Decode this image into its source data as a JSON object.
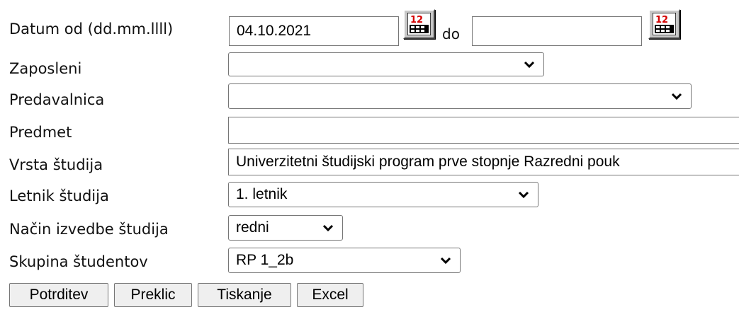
{
  "form": {
    "date_from_label": "Datum od (dd.mm.llll)",
    "date_from_value": "04.10.2021",
    "date_to_label": "do",
    "date_to_value": "",
    "employee_label": "Zaposleni",
    "employee_value": "",
    "room_label": "Predavalnica",
    "room_value": "",
    "subject_label": "Predmet",
    "subject_value": "",
    "study_type_label": "Vrsta študija",
    "study_type_value": "Univerzitetni študijski program prve stopnje Razredni pouk",
    "study_year_label": "Letnik študija",
    "study_year_value": "1. letnik",
    "study_mode_label": "Način izvedbe študija",
    "study_mode_value": "redni",
    "student_group_label": "Skupina študentov",
    "student_group_value": "RP 1_2b"
  },
  "buttons": {
    "confirm": "Potrditev",
    "cancel": "Preklic",
    "print": "Tiskanje",
    "excel": "Excel"
  },
  "icons": {
    "calendar": "calendar-icon",
    "dropdown": "chevron-down-icon"
  },
  "colors": {
    "calendar_face": "#c8c8c8",
    "calendar_numbers": "#d40000",
    "button_bg": "#efefef",
    "field_border": "#767676"
  }
}
